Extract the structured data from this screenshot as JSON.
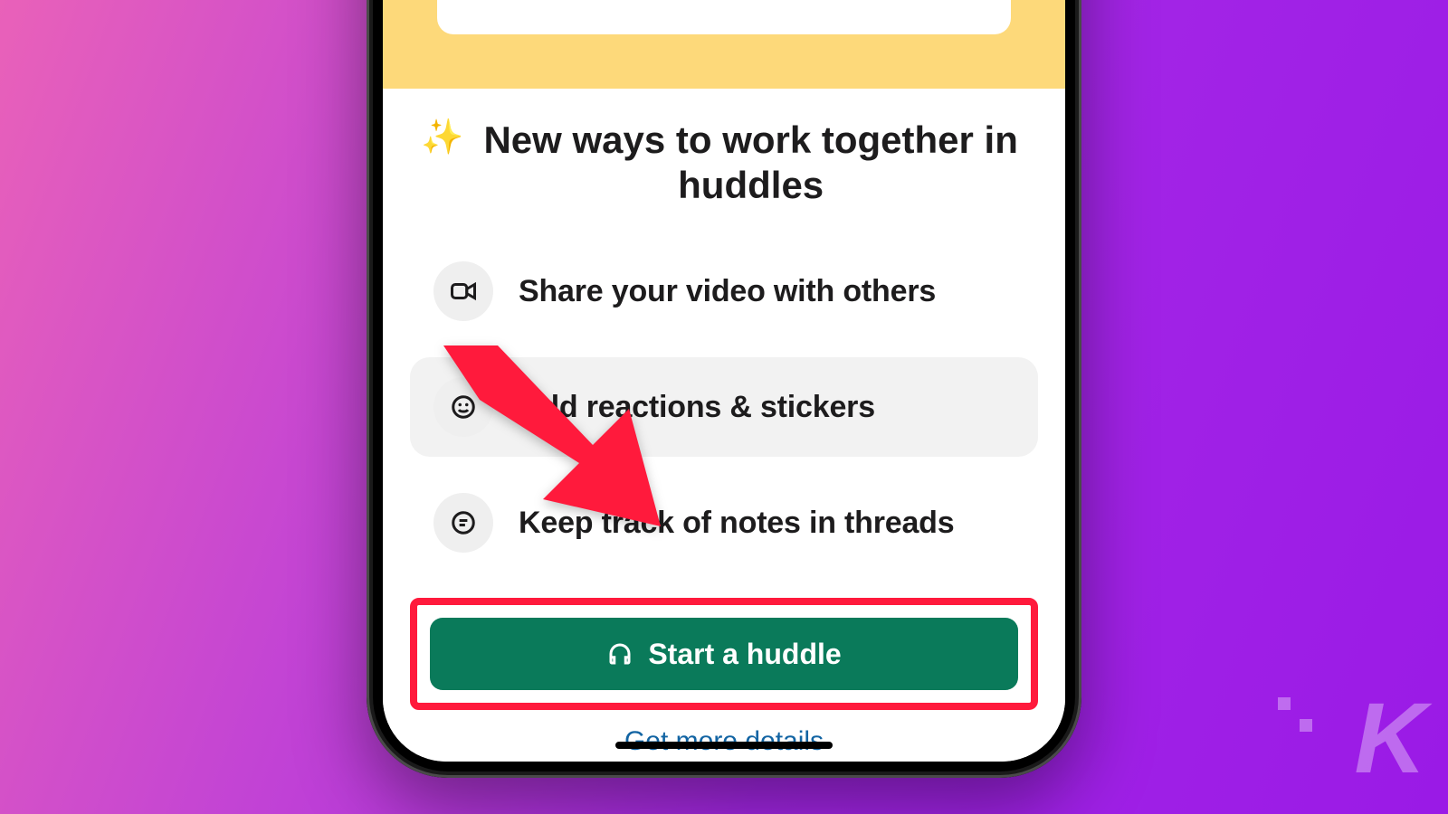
{
  "headline": {
    "sparkle": "✨",
    "text": "New ways to work together in huddles"
  },
  "features": [
    {
      "icon": "video-icon",
      "label": "Share your video with others",
      "highlight": false
    },
    {
      "icon": "smile-icon",
      "label": "Add reactions & stickers",
      "highlight": true
    },
    {
      "icon": "thread-icon",
      "label": "Keep track of notes in threads",
      "highlight": false
    }
  ],
  "cta": {
    "label": "Start a huddle"
  },
  "link": {
    "label": "Get more details"
  },
  "annotation": {
    "highlight_color": "#ff1a3c",
    "arrow_color": "#ff1a3c"
  },
  "watermark": "K"
}
